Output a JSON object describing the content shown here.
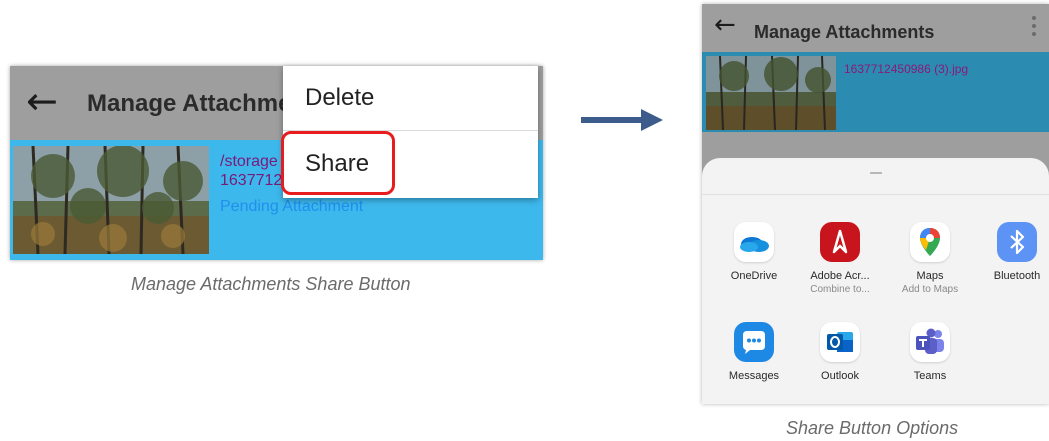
{
  "left_panel": {
    "title": "Manage Attachme",
    "path_line1": "/storage",
    "path_line2": "1637712",
    "status": "Pending Attachment",
    "menu": {
      "delete_label": "Delete",
      "share_label": "Share"
    },
    "caption": "Manage Attachments Share Button"
  },
  "right_panel": {
    "title": "Manage Attachments",
    "file_name": "1637712450986 (3).jpg",
    "apps": [
      {
        "name": "OneDrive",
        "subtitle": "",
        "icon": "onedrive-icon",
        "color": "#0f78d4"
      },
      {
        "name": "Adobe Acr...",
        "subtitle": "Combine to...",
        "icon": "adobe-acrobat-icon",
        "color": "#d41e1e"
      },
      {
        "name": "Maps",
        "subtitle": "Add to Maps",
        "icon": "google-maps-icon",
        "color": "#34a853"
      },
      {
        "name": "Bluetooth",
        "subtitle": "",
        "icon": "bluetooth-icon",
        "color": "#4e8ef7"
      },
      {
        "name": "Messages",
        "subtitle": "",
        "icon": "messages-icon",
        "color": "#1e88e5"
      },
      {
        "name": "Outlook",
        "subtitle": "",
        "icon": "outlook-icon",
        "color": "#0a64c8"
      },
      {
        "name": "Teams",
        "subtitle": "",
        "icon": "teams-icon",
        "color": "#5b5fc7"
      }
    ],
    "caption": "Share Button Options"
  },
  "colors": {
    "highlight": "#e81c1c",
    "arrow": "#3c5c8c",
    "row_selected": "#3db8ec"
  }
}
